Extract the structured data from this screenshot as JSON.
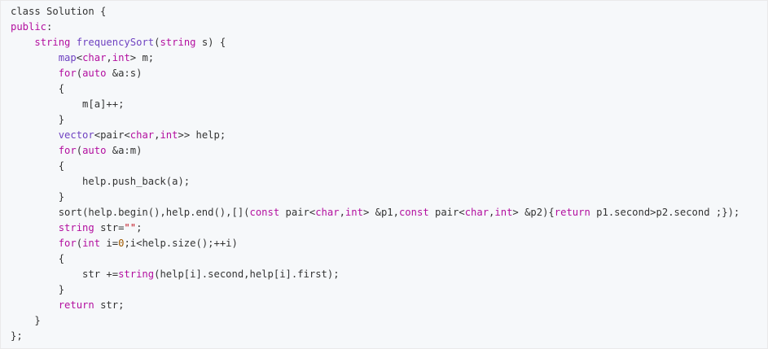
{
  "code": {
    "language": "cpp",
    "colors": {
      "background": "#f6f8fa",
      "keyword": "#b30f9f",
      "function": "#6f42c1",
      "string": "#c1121f",
      "number": "#a05a00",
      "plain": "#333333"
    },
    "lines": [
      [
        [
          "p",
          "class Solution {"
        ]
      ],
      [
        [
          "k",
          "public"
        ],
        [
          "p",
          ":"
        ]
      ],
      [
        [
          "p",
          "    "
        ],
        [
          "k",
          "string"
        ],
        [
          "p",
          " "
        ],
        [
          "f",
          "frequencySort"
        ],
        [
          "p",
          "("
        ],
        [
          "k",
          "string"
        ],
        [
          "p",
          " s) {"
        ]
      ],
      [
        [
          "p",
          "        "
        ],
        [
          "f",
          "map"
        ],
        [
          "p",
          "<"
        ],
        [
          "k",
          "char"
        ],
        [
          "p",
          ","
        ],
        [
          "k",
          "int"
        ],
        [
          "p",
          "> m;"
        ]
      ],
      [
        [
          "p",
          "        "
        ],
        [
          "k",
          "for"
        ],
        [
          "p",
          "("
        ],
        [
          "k",
          "auto"
        ],
        [
          "p",
          " &a:s)"
        ]
      ],
      [
        [
          "p",
          "        {"
        ]
      ],
      [
        [
          "p",
          "            m[a]++;"
        ]
      ],
      [
        [
          "p",
          "        }"
        ]
      ],
      [
        [
          "p",
          "        "
        ],
        [
          "f",
          "vector"
        ],
        [
          "p",
          "<pair<"
        ],
        [
          "k",
          "char"
        ],
        [
          "p",
          ","
        ],
        [
          "k",
          "int"
        ],
        [
          "p",
          ">> help;"
        ]
      ],
      [
        [
          "p",
          "        "
        ],
        [
          "k",
          "for"
        ],
        [
          "p",
          "("
        ],
        [
          "k",
          "auto"
        ],
        [
          "p",
          " &a:m)"
        ]
      ],
      [
        [
          "p",
          "        {"
        ]
      ],
      [
        [
          "p",
          "            help.push_back(a);"
        ]
      ],
      [
        [
          "p",
          "        }"
        ]
      ],
      [
        [
          "p",
          "        sort(help.begin(),help.end(),[]("
        ],
        [
          "k",
          "const"
        ],
        [
          "p",
          " pair<"
        ],
        [
          "k",
          "char"
        ],
        [
          "p",
          ","
        ],
        [
          "k",
          "int"
        ],
        [
          "p",
          "> &p1,"
        ],
        [
          "k",
          "const"
        ],
        [
          "p",
          " pair<"
        ],
        [
          "k",
          "char"
        ],
        [
          "p",
          ","
        ],
        [
          "k",
          "int"
        ],
        [
          "p",
          "> &p2){"
        ],
        [
          "k",
          "return"
        ],
        [
          "p",
          " p1.second>p2.second ;});"
        ]
      ],
      [
        [
          "p",
          "        "
        ],
        [
          "k",
          "string"
        ],
        [
          "p",
          " str="
        ],
        [
          "s",
          "\"\""
        ],
        [
          "p",
          ";"
        ]
      ],
      [
        [
          "p",
          "        "
        ],
        [
          "k",
          "for"
        ],
        [
          "p",
          "("
        ],
        [
          "k",
          "int"
        ],
        [
          "p",
          " i="
        ],
        [
          "n",
          "0"
        ],
        [
          "p",
          ";i<help.size();++i)"
        ]
      ],
      [
        [
          "p",
          "        {"
        ]
      ],
      [
        [
          "p",
          "            str +="
        ],
        [
          "k",
          "string"
        ],
        [
          "p",
          "(help[i].second,help[i].first);"
        ]
      ],
      [
        [
          "p",
          "        }"
        ]
      ],
      [
        [
          "p",
          "        "
        ],
        [
          "k",
          "return"
        ],
        [
          "p",
          " str;"
        ]
      ],
      [
        [
          "p",
          "    }"
        ]
      ],
      [
        [
          "p",
          "};"
        ]
      ]
    ]
  }
}
